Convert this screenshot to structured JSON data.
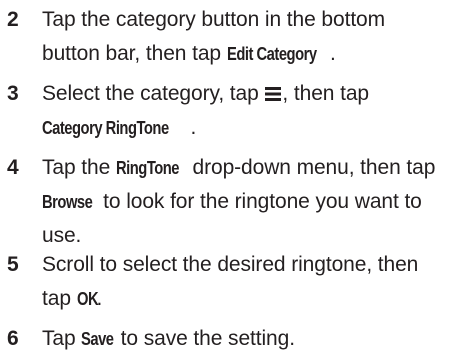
{
  "steps": [
    {
      "number": "2",
      "line1_a": "Tap the category button in the bottom",
      "line2_a": "button bar, then tap ",
      "line2_kw": "Edit Category",
      "line2_b": "."
    },
    {
      "number": "3",
      "line1_a": "Select the category, tap ",
      "icon": "menu-icon",
      "line1_b": ", then tap",
      "line2_kw": "Category RingTone",
      "line2_b": "."
    },
    {
      "number": "4",
      "line1_a": "Tap the ",
      "line1_kw": "RingTone",
      "line1_b": " drop-down menu, then tap",
      "line2_kw": "Browse",
      "line2_b": " to look for the ringtone you want to",
      "line3": "use."
    },
    {
      "number": "5",
      "line1_a": "Scroll to select the desired ringtone, then",
      "line2_a": "tap ",
      "line2_kw": "OK",
      "line2_b": "."
    },
    {
      "number": "6",
      "line1_a": "Tap ",
      "line1_kw": "Save",
      "line1_b": " to save the setting."
    }
  ]
}
